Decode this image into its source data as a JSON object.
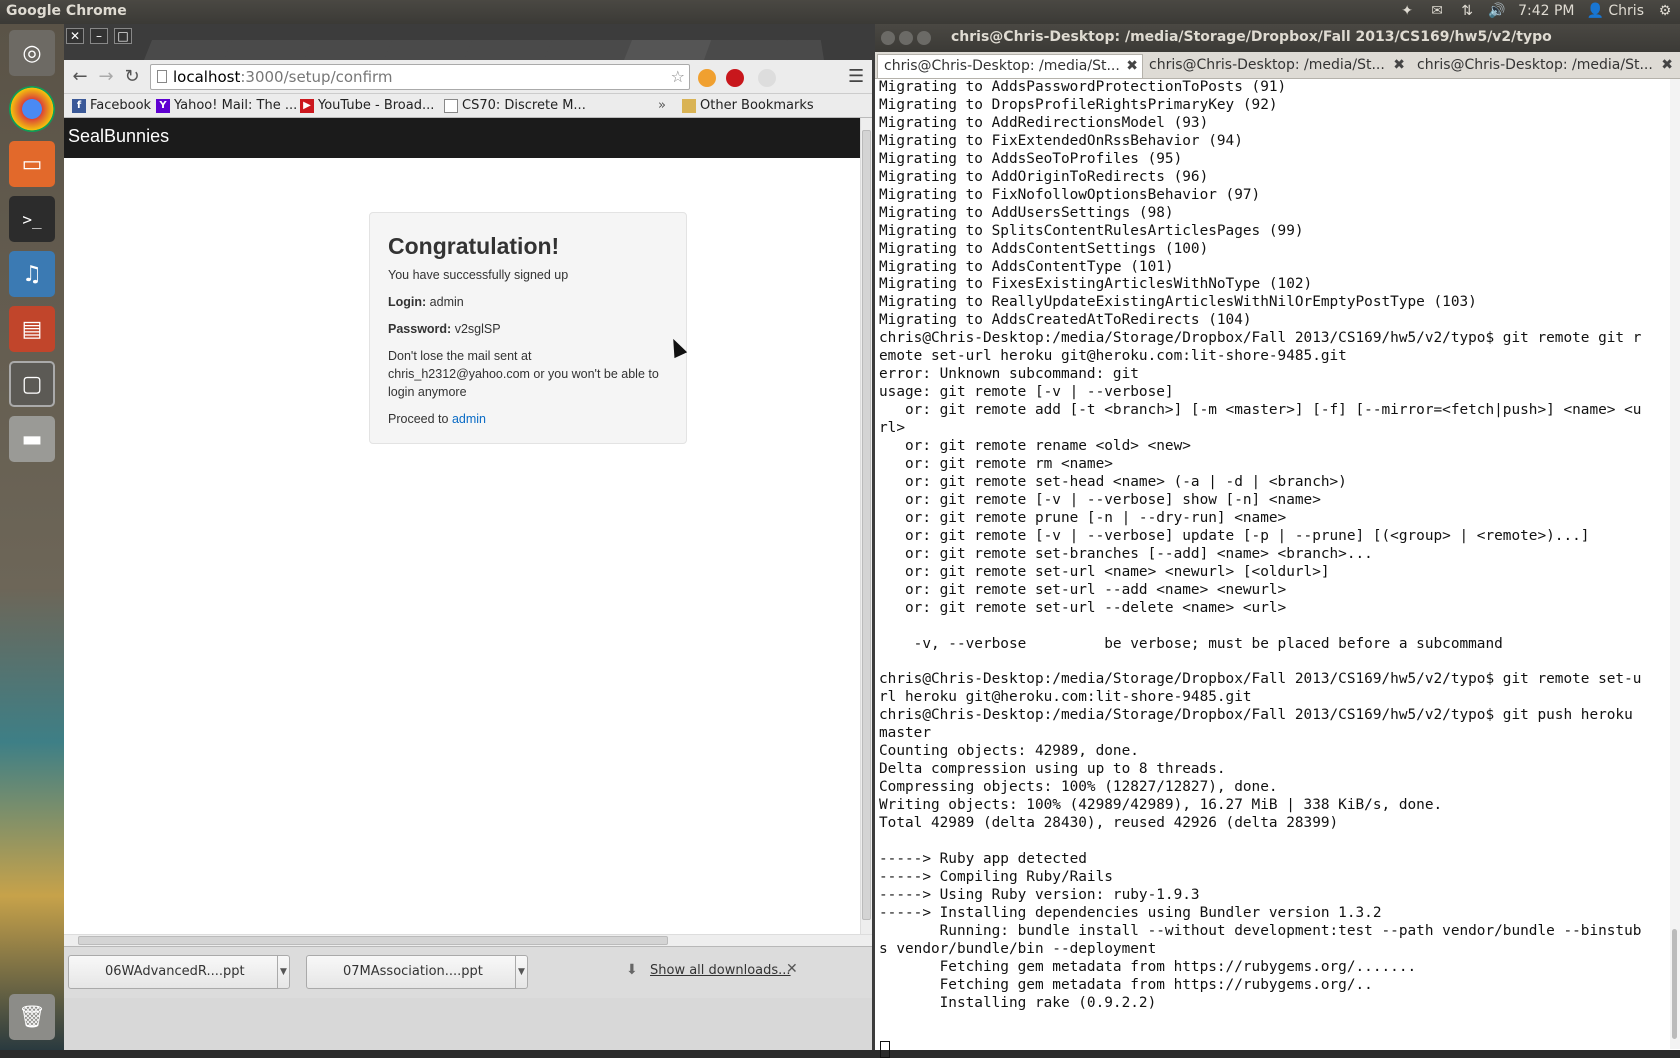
{
  "top_panel": {
    "app_title": "Google Chrome",
    "time": "7:42 PM",
    "user": "Chris"
  },
  "browser": {
    "url_host": "localhost",
    "url_path": ":3000/setup/confirm",
    "bookmarks": [
      {
        "label": "Facebook",
        "icon": "facebook-icon",
        "color": "#3b5998"
      },
      {
        "label": "Yahoo! Mail: The ...",
        "icon": "yahoo-icon",
        "color": "#5f01d1"
      },
      {
        "label": "YouTube - Broad...",
        "icon": "youtube-icon",
        "color": "#cc181e"
      },
      {
        "label": "CS70: Discrete M...",
        "icon": "page-icon",
        "color": "#777777"
      }
    ],
    "bookmarks_overflow": "»",
    "other_bookmarks": "Other Bookmarks",
    "site_brand": "SealBunnies",
    "confirm": {
      "heading": "Congratulation!",
      "subtitle": "You have successfully signed up",
      "login_label": "Login:",
      "login_value": "admin",
      "password_label": "Password:",
      "password_value": "v2sglSP",
      "mail_notice": "Don't lose the mail sent at chris_h2312@yahoo.com or you won't be able to login anymore",
      "proceed_text": "Proceed to",
      "proceed_link": "admin"
    },
    "downloads": [
      {
        "label": "06WAdvancedR....ppt"
      },
      {
        "label": "07MAssociation....ppt"
      }
    ],
    "show_all": "Show all downloads..."
  },
  "terminal": {
    "title": "chris@Chris-Desktop: /media/Storage/Dropbox/Fall 2013/CS169/hw5/v2/typo",
    "tabs": [
      {
        "label": "chris@Chris-Desktop: /media/St..."
      },
      {
        "label": "chris@Chris-Desktop: /media/St..."
      },
      {
        "label": "chris@Chris-Desktop: /media/St..."
      }
    ],
    "lines": [
      "Migrating to AddsPasswordProtectionToPosts (91)",
      "Migrating to DropsProfileRightsPrimaryKey (92)",
      "Migrating to AddRedirectionsModel (93)",
      "Migrating to FixExtendedOnRssBehavior (94)",
      "Migrating to AddsSeoToProfiles (95)",
      "Migrating to AddOriginToRedirects (96)",
      "Migrating to FixNofollowOptionsBehavior (97)",
      "Migrating to AddUsersSettings (98)",
      "Migrating to SplitsContentRulesArticlesPages (99)",
      "Migrating to AddsContentSettings (100)",
      "Migrating to AddsContentType (101)",
      "Migrating to FixesExistingArticlesWithNoType (102)",
      "Migrating to ReallyUpdateExistingArticlesWithNilOrEmptyPostType (103)",
      "Migrating to AddsCreatedAtToRedirects (104)",
      "chris@Chris-Desktop:/media/Storage/Dropbox/Fall 2013/CS169/hw5/v2/typo$ git remote git r",
      "emote set-url heroku git@heroku.com:lit-shore-9485.git",
      "error: Unknown subcommand: git",
      "usage: git remote [-v | --verbose]",
      "   or: git remote add [-t <branch>] [-m <master>] [-f] [--mirror=<fetch|push>] <name> <u",
      "rl>",
      "   or: git remote rename <old> <new>",
      "   or: git remote rm <name>",
      "   or: git remote set-head <name> (-a | -d | <branch>)",
      "   or: git remote [-v | --verbose] show [-n] <name>",
      "   or: git remote prune [-n | --dry-run] <name>",
      "   or: git remote [-v | --verbose] update [-p | --prune] [(<group> | <remote>)...]",
      "   or: git remote set-branches [--add] <name> <branch>...",
      "   or: git remote set-url <name> <newurl> [<oldurl>]",
      "   or: git remote set-url --add <name> <newurl>",
      "   or: git remote set-url --delete <name> <url>",
      "",
      "    -v, --verbose         be verbose; must be placed before a subcommand",
      "",
      "chris@Chris-Desktop:/media/Storage/Dropbox/Fall 2013/CS169/hw5/v2/typo$ git remote set-u",
      "rl heroku git@heroku.com:lit-shore-9485.git",
      "chris@Chris-Desktop:/media/Storage/Dropbox/Fall 2013/CS169/hw5/v2/typo$ git push heroku",
      "master",
      "Counting objects: 42989, done.",
      "Delta compression using up to 8 threads.",
      "Compressing objects: 100% (12827/12827), done.",
      "Writing objects: 100% (42989/42989), 16.27 MiB | 338 KiB/s, done.",
      "Total 42989 (delta 28430), reused 42926 (delta 28399)",
      "",
      "-----> Ruby app detected",
      "-----> Compiling Ruby/Rails",
      "-----> Using Ruby version: ruby-1.9.3",
      "-----> Installing dependencies using Bundler version 1.3.2",
      "       Running: bundle install --without development:test --path vendor/bundle --binstub",
      "s vendor/bundle/bin --deployment",
      "       Fetching gem metadata from https://rubygems.org/.......",
      "       Fetching gem metadata from https://rubygems.org/..",
      "       Installing rake (0.9.2.2)"
    ]
  }
}
